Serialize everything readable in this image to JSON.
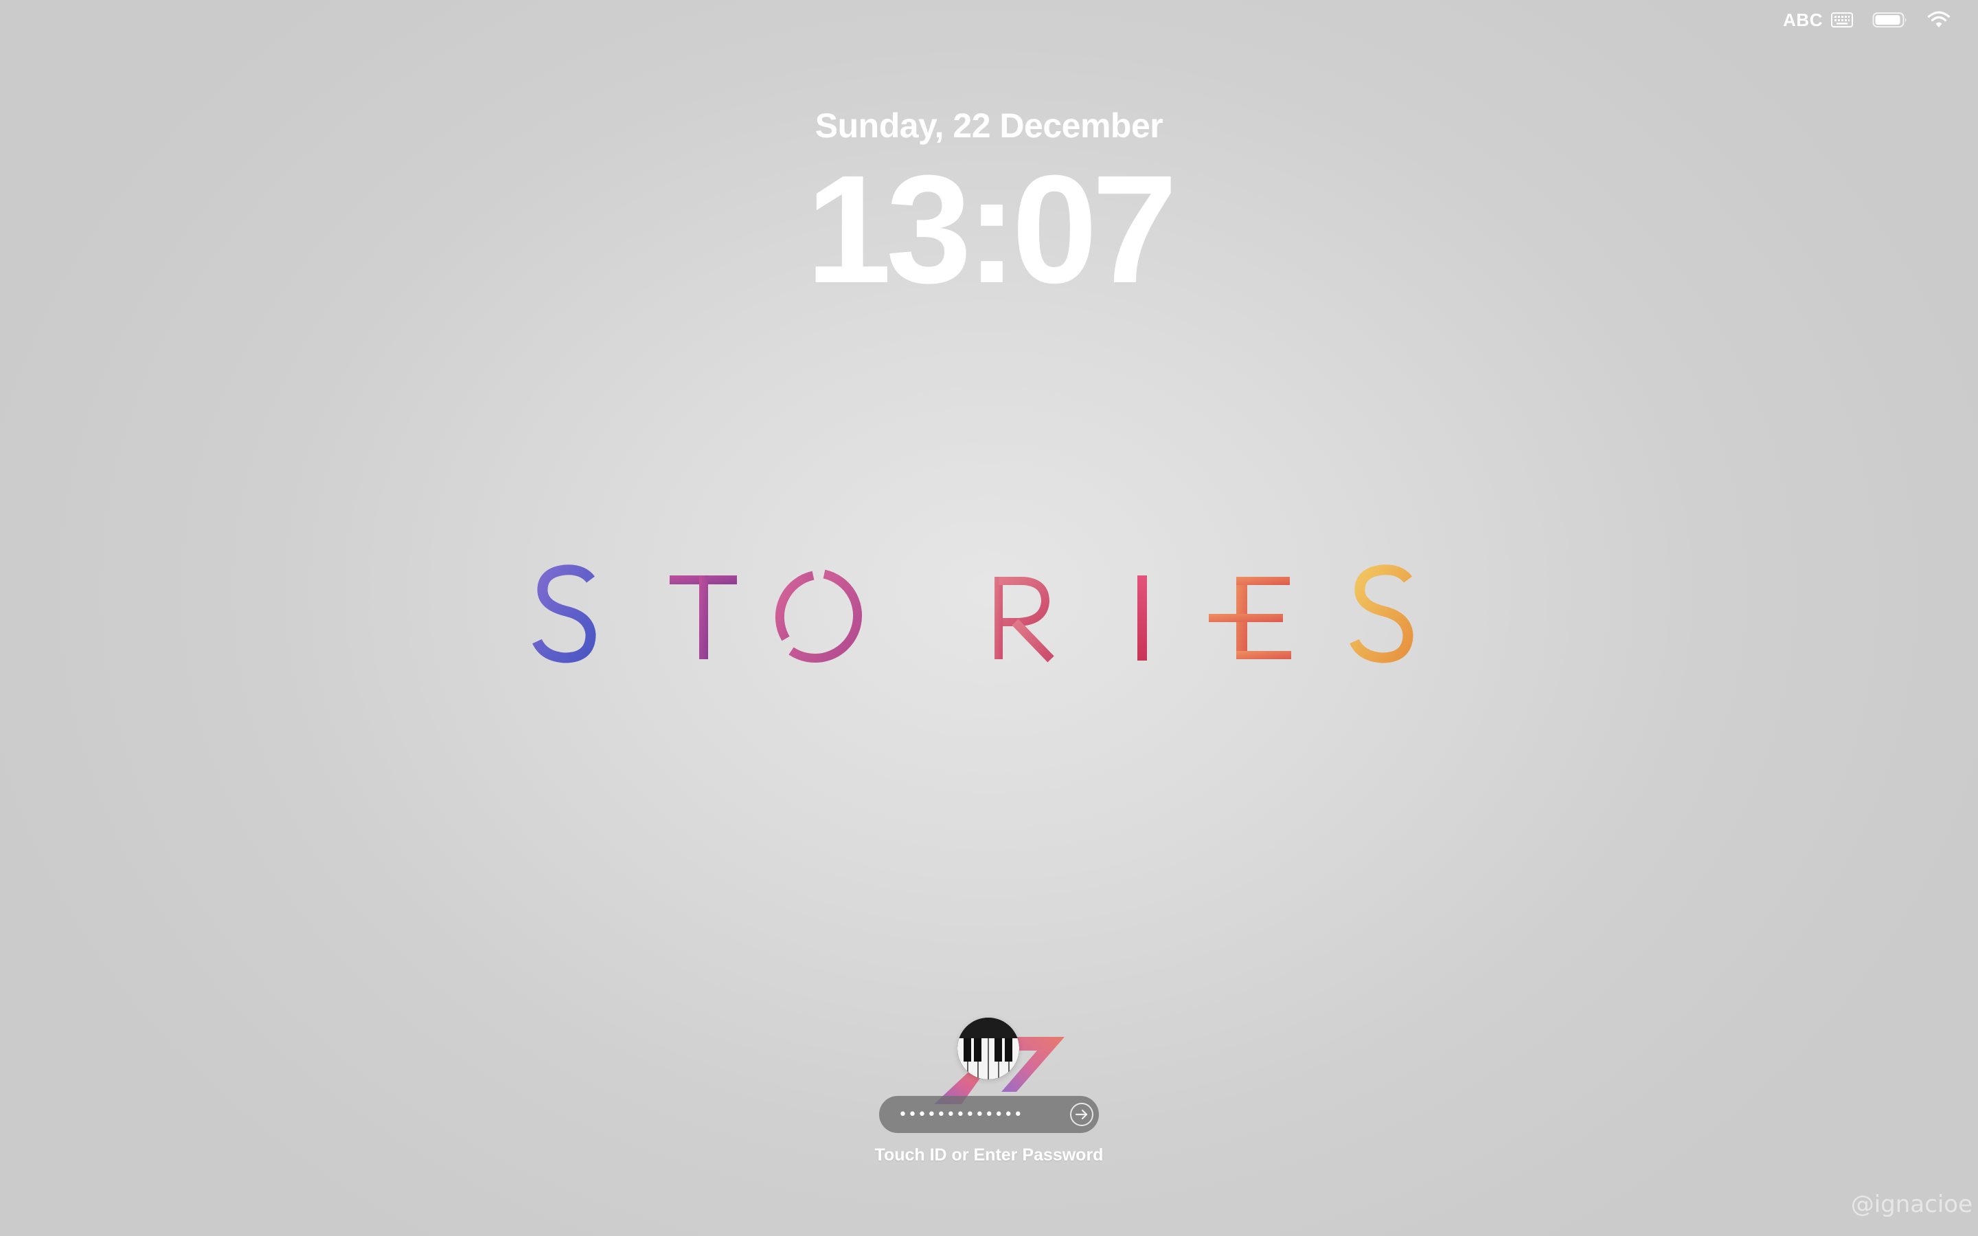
{
  "menubar": {
    "input_source_label": "ABC",
    "icons": [
      "keyboard-icon",
      "battery-icon",
      "wifi-icon"
    ],
    "battery_level": 0.9
  },
  "clock": {
    "date": "Sunday, 22 December",
    "time": "13:07"
  },
  "wallpaper": {
    "title": "STORIES",
    "letter_colors": [
      "#5a63c8",
      "#a0459a",
      "#c85a9c",
      "#d8557a",
      "#d94265",
      "#e2704a",
      "#e9b049"
    ]
  },
  "login": {
    "password_mask": "•••••••••••••",
    "hint": "Touch ID or Enter Password",
    "avatar_icon": "piano-keys-icon",
    "submit_icon": "arrow-right-circle-icon"
  },
  "watermark": "@ignacioe"
}
